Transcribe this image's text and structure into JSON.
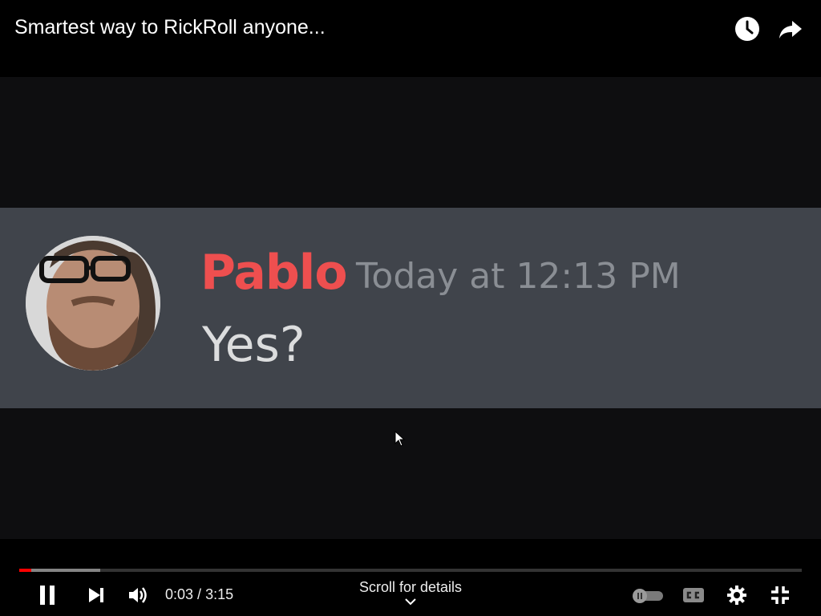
{
  "header": {
    "title": "Smartest way to RickRoll anyone...",
    "watch_later_icon": "clock-icon",
    "share_icon": "share-arrow-icon"
  },
  "video": {
    "message": {
      "author": "Pablo",
      "timestamp": "Today at 12:13 PM",
      "text": "Yes?",
      "author_color": "#ee4f4f"
    }
  },
  "player": {
    "current_time": "0:03",
    "duration": "3:15",
    "time_separator": " / ",
    "progress_played_fraction": 0.015,
    "progress_buffered_fraction": 0.103,
    "scroll_hint": "Scroll for details",
    "accent_color": "#ff0000",
    "icons": [
      "pause-icon",
      "next-icon",
      "volume-icon",
      "autoplay-toggle-icon",
      "captions-icon",
      "settings-gear-icon",
      "exit-fullscreen-icon"
    ]
  }
}
